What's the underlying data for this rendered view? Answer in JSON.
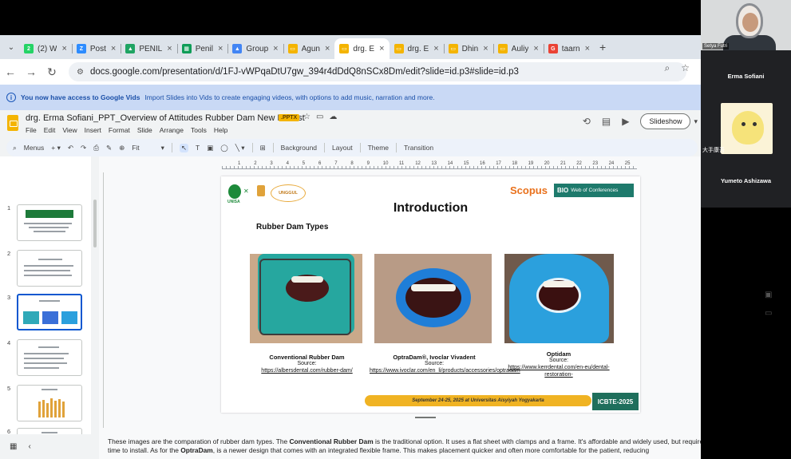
{
  "browser": {
    "tabs": [
      {
        "title": "(2) W",
        "icon": "whatsapp-icon",
        "color": "#25d366",
        "glyph": "2",
        "active": false
      },
      {
        "title": "Post",
        "icon": "zoom-icon",
        "color": "#2d8cff",
        "glyph": "Z",
        "active": false
      },
      {
        "title": "PENIL",
        "icon": "drive-icon",
        "color": "#1fa463",
        "glyph": "▲",
        "active": false
      },
      {
        "title": "Penil",
        "icon": "sheets-icon",
        "color": "#0f9d58",
        "glyph": "▦",
        "active": false
      },
      {
        "title": "Group",
        "icon": "drive-icon",
        "color": "#4285f4",
        "glyph": "▲",
        "active": false
      },
      {
        "title": "Agun",
        "icon": "slides-icon",
        "color": "#f4b400",
        "glyph": "▭",
        "active": false
      },
      {
        "title": "drg. E",
        "icon": "slides-icon",
        "color": "#f4b400",
        "glyph": "▭",
        "active": true
      },
      {
        "title": "drg. E",
        "icon": "slides-icon",
        "color": "#f4b400",
        "glyph": "▭",
        "active": false
      },
      {
        "title": "Dhin",
        "icon": "slides-icon",
        "color": "#f4b400",
        "glyph": "▭",
        "active": false
      },
      {
        "title": "Auliy",
        "icon": "slides-icon",
        "color": "#f4b400",
        "glyph": "▭",
        "active": false
      },
      {
        "title": "taarn",
        "icon": "google-icon",
        "color": "#ea4335",
        "glyph": "G",
        "active": false
      }
    ],
    "url": "docs.google.com/presentation/d/1FJ-vWPqaDtU7gw_394r4dDdQ8nSCx8Dm/edit?slide=id.p3#slide=id.p3"
  },
  "banner": {
    "lead": "You now have access to Google Vids",
    "rest": "Import Slides into Vids to create engaging videos, with options to add music, narration and more."
  },
  "doc": {
    "title": "drg. Erma Sofiani_PPT_Overview of Attitudes Rubber Dam New Dentist",
    "badge": ".PPTX",
    "menus": [
      "File",
      "Edit",
      "View",
      "Insert",
      "Format",
      "Slide",
      "Arrange",
      "Tools",
      "Help"
    ],
    "slideshow_label": "Slideshow"
  },
  "edit_toolbar": {
    "menus_label": "Menus",
    "zoom_label": "Fit",
    "background_label": "Background",
    "layout_label": "Layout",
    "theme_label": "Theme",
    "transition_label": "Transition"
  },
  "filmstrip": {
    "numbers": [
      "1",
      "2",
      "3",
      "4",
      "5",
      "6"
    ]
  },
  "ruler": {
    "labels": [
      "1",
      "2",
      "3",
      "4",
      "5",
      "6",
      "7",
      "8",
      "9",
      "10",
      "11",
      "12",
      "13",
      "14",
      "15",
      "16",
      "17",
      "18",
      "19",
      "20",
      "21",
      "22",
      "23",
      "24",
      "25"
    ]
  },
  "slide": {
    "title": "Introduction",
    "subtitle": "Rubber Dam Types",
    "logo_left_text": "UNISA",
    "logo_unggul_text": "UNGGUL",
    "scopus": "Scopus",
    "bio_label": "BIO",
    "bio_text": "Web of Conferences",
    "items": [
      {
        "name": "Conventional Rubber Dam",
        "source_label": "Source:",
        "link": "https://albersdental.com/rubber-dam/"
      },
      {
        "name": "OptraDam®, Ivoclar Vivadent",
        "source_label": "Source:",
        "link": "https://www.ivoclar.com/en_li/products/accessories/optradam"
      },
      {
        "name": "Optidam",
        "source_label": "Source:",
        "link": "https://www.kerrdental.com/en-eu/dental-restoration-"
      }
    ],
    "date_text": "September 24-25, 2025 at Universitas Aisyiyah Yogyakarta",
    "conference": "ICBTE-2025"
  },
  "notes": {
    "p1": "These images are the comparation of rubber dam types. The ",
    "b1": "Conventional Rubber Dam",
    "p2": " is the traditional option. It uses a flat sheet with clamps and a frame. It's affordable and widely used, but requires more skill and time to install. As for the ",
    "b2": "OptraDam",
    "p3": ", is a newer design that comes with an integrated flexible frame. This makes placement quicker and often more comfortable for the patient, reducing"
  },
  "video_call": {
    "tile_label": "Setya Futri",
    "participant_1": "Erma Sofiani",
    "participant_2_chip": "大手康吾",
    "participant_3": "Yumeto Ashizawa"
  }
}
